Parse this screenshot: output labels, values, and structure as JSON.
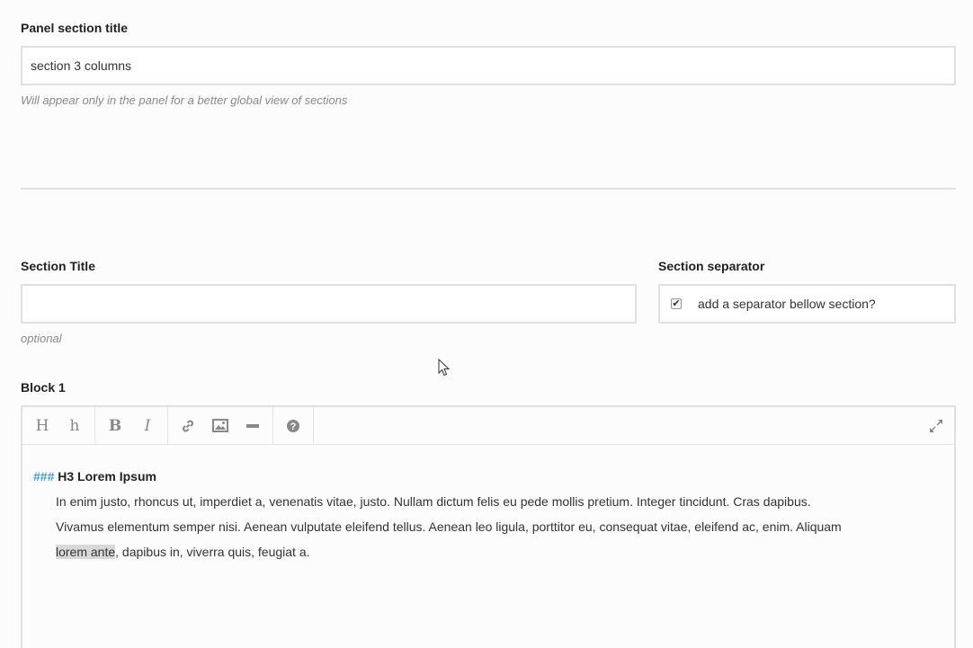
{
  "panel_section": {
    "label": "Panel section title",
    "value": "section 3 columns",
    "help": "Will appear only in the panel for a better global view of sections"
  },
  "section_title": {
    "label": "Section Title",
    "value": "",
    "help": "optional"
  },
  "section_separator": {
    "label": "Section separator",
    "checkbox_label": "add a separator bellow section?",
    "checked": true
  },
  "block1": {
    "label": "Block 1",
    "toolbar": {
      "heading_large": "H",
      "heading_small": "h",
      "bold": "B",
      "italic": "I",
      "link_icon": "link-icon",
      "image_icon": "image-icon",
      "hr_icon": "horizontal-rule-icon",
      "help_icon": "help-icon",
      "fullscreen_icon": "fullscreen-icon"
    },
    "content": {
      "heading_marker": "###",
      "heading_text": " H3 Lorem Ipsum",
      "line1": "In enim justo, rhoncus ut, imperdiet a, venenatis vitae, justo. Nullam dictum felis eu pede mollis pretium. Integer tincidunt. Cras dapibus.",
      "line2": "Vivamus elementum semper nisi. Aenean vulputate eleifend tellus. Aenean leo ligula, porttitor eu, consequat vitae, eleifend ac, enim. Aliquam",
      "line3_selected": "lorem ante",
      "line3_rest": ", dapibus in, viverra quis, feugiat a."
    }
  },
  "colors": {
    "accent": "#3aa0d8",
    "border": "#e0e0e0",
    "selection": "#d8d8d8"
  }
}
